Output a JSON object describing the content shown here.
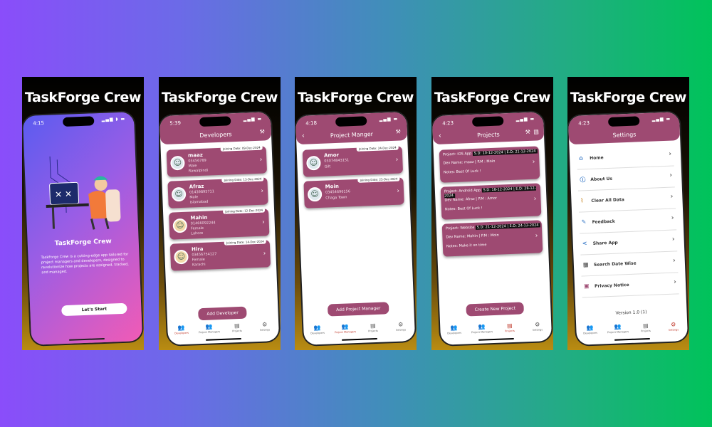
{
  "app_name": "TaskForge Crew",
  "onboarding": {
    "time": "4:15",
    "title": "TaskForge Crew",
    "description": "TaskForge Crew is a cutting-edge app tailored for project managers and developers, designed to revolutionize how projects are assigned, tracked, and managed.",
    "start_button": "Let's Start"
  },
  "developers": {
    "time": "5:39",
    "title": "Developers",
    "cards": [
      {
        "name": "maaz",
        "phone": "03456789",
        "gender": "Male",
        "city": "Rawalpindi",
        "badge": "Joining Date: 09-Dec-2024"
      },
      {
        "name": "Afraz",
        "phone": "01439895711",
        "gender": "Male",
        "city": "Islamabad",
        "badge": "Joining Date: 13-Dec-2024"
      },
      {
        "name": "Mahin",
        "phone": "01466092244",
        "gender": "Female",
        "city": "Lahore",
        "badge": "Joining Date: 12-Dec-2024"
      },
      {
        "name": "Hira",
        "phone": "03456754127",
        "gender": "Female",
        "city": "Karachi",
        "badge": "Joining Date: 14-Dec-2024"
      }
    ],
    "add_button": "Add Developer"
  },
  "managers": {
    "time": "4:18",
    "title": "Project Manger",
    "cards": [
      {
        "name": "Amor",
        "phone": "03074843151",
        "city": "Gilt",
        "badge": "Joining Date: 24-Dec-2024"
      },
      {
        "name": "Moin",
        "phone": "03454696156",
        "city": "Chaga Town",
        "badge": "Joining Date: 25-Dec-2024"
      }
    ],
    "add_button": "Add Project Manager"
  },
  "projects": {
    "time": "4:23",
    "title": "Projects",
    "cards": [
      {
        "project": "Project: iOS App",
        "dates": "S.D: 10-12-2024 | E.D: 21-12-2024",
        "dev": "Dev Name: maaz",
        "pm": "P.M : Moin",
        "notes": "Notes: Best Of Luck !"
      },
      {
        "project": "Project: Android App",
        "dates": "S.D: 18-12-2024 | E.D: 28-12-2024",
        "dev": "Dev Name: Afraz",
        "pm": "P.M : Amor",
        "notes": "Notes: Best Of Luck !"
      },
      {
        "project": "Project: Website",
        "dates": "S.D: 21-12-2024 | E.D: 24-12-2024",
        "dev": "Dev Name: Mahin",
        "pm": "P.M : Moin",
        "notes": "Notes: Make it on time"
      }
    ],
    "add_button": "Create New Project"
  },
  "settings": {
    "time": "4:23",
    "title": "Settings",
    "items": [
      {
        "label": "Home",
        "icon": "home-icon"
      },
      {
        "label": "About Us",
        "icon": "info-icon"
      },
      {
        "label": "Clear All Data",
        "icon": "broom-icon"
      },
      {
        "label": "Feedback",
        "icon": "feedback-icon"
      },
      {
        "label": "Share App",
        "icon": "share-icon"
      },
      {
        "label": "Search Date Wise",
        "icon": "calendar-icon"
      },
      {
        "label": "Privacy Notice",
        "icon": "privacy-icon"
      }
    ],
    "version": "Version 1.0 (1)"
  },
  "tabs": [
    "Developers",
    "Project Managers",
    "Projects",
    "Settings"
  ],
  "colors": {
    "accent": "#9e4a72",
    "active_tab": "#c0392b"
  }
}
